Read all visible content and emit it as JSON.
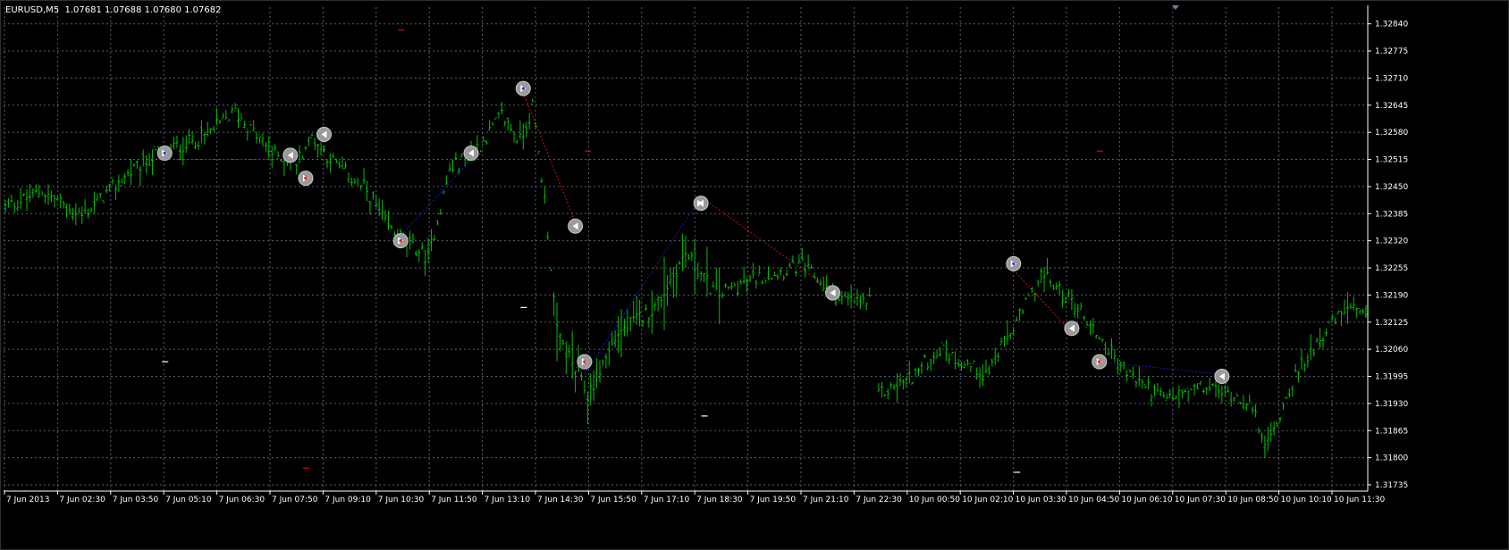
{
  "chart_data": {
    "type": "bar",
    "symbol": "EURUSD,M5",
    "ohlc": [
      "1.07681",
      "1.07688",
      "1.07680",
      "1.07682"
    ],
    "y_ticks": [
      "1.32840",
      "1.32775",
      "1.32710",
      "1.32645",
      "1.32580",
      "1.32515",
      "1.32450",
      "1.32385",
      "1.32320",
      "1.32255",
      "1.32190",
      "1.32125",
      "1.32060",
      "1.31995",
      "1.31930",
      "1.31865",
      "1.31800",
      "1.31735"
    ],
    "y_tick_values": [
      1.3284,
      1.32775,
      1.3271,
      1.32645,
      1.3258,
      1.32515,
      1.3245,
      1.32385,
      1.3232,
      1.32255,
      1.3219,
      1.32125,
      1.3206,
      1.31995,
      1.3193,
      1.31865,
      1.318,
      1.31735
    ],
    "ylim": [
      1.3172,
      1.3288
    ],
    "x_ticks": [
      "7 Jun 2013",
      "7 Jun 02:30",
      "7 Jun 03:50",
      "7 Jun 05:10",
      "7 Jun 06:30",
      "7 Jun 07:50",
      "7 Jun 09:10",
      "7 Jun 10:30",
      "7 Jun 11:50",
      "7 Jun 13:10",
      "7 Jun 14:30",
      "7 Jun 15:50",
      "7 Jun 17:10",
      "7 Jun 18:30",
      "7 Jun 19:50",
      "7 Jun 21:10",
      "7 Jun 22:30",
      "10 Jun 00:50",
      "10 Jun 02:10",
      "10 Jun 03:30",
      "10 Jun 04:50",
      "10 Jun 06:10",
      "10 Jun 07:30",
      "10 Jun 08:50",
      "10 Jun 10:10",
      "10 Jun 11:30"
    ],
    "bar_count": 420,
    "grid": true,
    "colors": {
      "background": "#000000",
      "bars": "#00c000",
      "grid": "#5a6070",
      "text": "#ffffff",
      "buy_line": "#1020c0",
      "sell_line": "#d01010",
      "marker": "#a0a0a0"
    },
    "path_anchors": [
      {
        "bar": 0,
        "price": 1.324
      },
      {
        "bar": 12,
        "price": 1.3244
      },
      {
        "bar": 25,
        "price": 1.3238
      },
      {
        "bar": 40,
        "price": 1.3248
      },
      {
        "bar": 50,
        "price": 1.3253
      },
      {
        "bar": 65,
        "price": 1.3257
      },
      {
        "bar": 75,
        "price": 1.3263
      },
      {
        "bar": 87,
        "price": 1.3253
      },
      {
        "bar": 95,
        "price": 1.3251
      },
      {
        "bar": 100,
        "price": 1.3257
      },
      {
        "bar": 108,
        "price": 1.325
      },
      {
        "bar": 118,
        "price": 1.3244
      },
      {
        "bar": 125,
        "price": 1.3235
      },
      {
        "bar": 138,
        "price": 1.3228
      },
      {
        "bar": 145,
        "price": 1.3249
      },
      {
        "bar": 155,
        "price": 1.3255
      },
      {
        "bar": 162,
        "price": 1.3262
      },
      {
        "bar": 168,
        "price": 1.3256
      },
      {
        "bar": 172,
        "price": 1.3264
      },
      {
        "bar": 176,
        "price": 1.3242
      },
      {
        "bar": 180,
        "price": 1.321
      },
      {
        "bar": 190,
        "price": 1.3195
      },
      {
        "bar": 200,
        "price": 1.321
      },
      {
        "bar": 212,
        "price": 1.3216
      },
      {
        "bar": 222,
        "price": 1.3229
      },
      {
        "bar": 232,
        "price": 1.3219
      },
      {
        "bar": 245,
        "price": 1.3223
      },
      {
        "bar": 260,
        "price": 1.3226
      },
      {
        "bar": 272,
        "price": 1.3218
      },
      {
        "bar": 282,
        "price": 1.3217
      },
      {
        "bar": 285,
        "price": 1.3195
      },
      {
        "bar": 295,
        "price": 1.3199
      },
      {
        "bar": 305,
        "price": 1.3206
      },
      {
        "bar": 320,
        "price": 1.32
      },
      {
        "bar": 332,
        "price": 1.3215
      },
      {
        "bar": 338,
        "price": 1.3224
      },
      {
        "bar": 350,
        "price": 1.3216
      },
      {
        "bar": 365,
        "price": 1.3201
      },
      {
        "bar": 378,
        "price": 1.3194
      },
      {
        "bar": 392,
        "price": 1.3197
      },
      {
        "bar": 405,
        "price": 1.3194
      },
      {
        "bar": 412,
        "price": 1.3183
      },
      {
        "bar": 420,
        "price": 1.3198
      },
      {
        "bar": 428,
        "price": 1.3208
      },
      {
        "bar": 438,
        "price": 1.3216
      },
      {
        "bar": 444,
        "price": 1.3213
      }
    ],
    "gap_after_bar": 282,
    "trade_lines": [
      {
        "type": "sell",
        "from": {
          "bar": 50,
          "price": 1.32515
        },
        "to": {
          "bar": 91,
          "price": 1.32515
        }
      },
      {
        "type": "buy",
        "from": {
          "bar": 130,
          "price": 1.3234
        },
        "to": {
          "bar": 152,
          "price": 1.32515
        }
      },
      {
        "type": "sell",
        "from": {
          "bar": 169,
          "price": 1.32675
        },
        "to": {
          "bar": 186,
          "price": 1.32365
        }
      },
      {
        "type": "buy",
        "from": {
          "bar": 189,
          "price": 1.32
        },
        "to": {
          "bar": 227,
          "price": 1.32425
        }
      },
      {
        "type": "sell",
        "from": {
          "bar": 227,
          "price": 1.32425
        },
        "to": {
          "bar": 270,
          "price": 1.322
        }
      },
      {
        "type": "sell",
        "from": {
          "bar": 329,
          "price": 1.3225
        },
        "to": {
          "bar": 348,
          "price": 1.321
        }
      },
      {
        "type": "buy",
        "from": {
          "bar": 357,
          "price": 1.3203
        },
        "to": {
          "bar": 397,
          "price": 1.32
        }
      }
    ],
    "trade_markers": [
      {
        "bar": 52,
        "price": 1.3253,
        "kind": "buy"
      },
      {
        "bar": 93,
        "price": 1.32525,
        "kind": "close"
      },
      {
        "bar": 98,
        "price": 1.3247,
        "kind": "sell"
      },
      {
        "bar": 104,
        "price": 1.32575,
        "kind": "close"
      },
      {
        "bar": 129,
        "price": 1.3232,
        "kind": "sell"
      },
      {
        "bar": 152,
        "price": 1.3253,
        "kind": "close"
      },
      {
        "bar": 169,
        "price": 1.32685,
        "kind": "buy"
      },
      {
        "bar": 186,
        "price": 1.32355,
        "kind": "close"
      },
      {
        "bar": 189,
        "price": 1.3203,
        "kind": "sell"
      },
      {
        "bar": 227,
        "price": 1.3241,
        "kind": "closebuy"
      },
      {
        "bar": 270,
        "price": 1.32195,
        "kind": "close"
      },
      {
        "bar": 329,
        "price": 1.32265,
        "kind": "buy"
      },
      {
        "bar": 348,
        "price": 1.3211,
        "kind": "close"
      },
      {
        "bar": 357,
        "price": 1.3203,
        "kind": "sell"
      },
      {
        "bar": 397,
        "price": 1.31995,
        "kind": "close"
      }
    ],
    "dashes": [
      {
        "bar": 129,
        "price": 1.32825,
        "color": "#d01010"
      },
      {
        "bar": 190,
        "price": 1.32535,
        "color": "#d01010"
      },
      {
        "bar": 357,
        "price": 1.32535,
        "color": "#d01010"
      },
      {
        "bar": 52,
        "price": 1.3203,
        "color": "#ffffff"
      },
      {
        "bar": 169,
        "price": 1.3216,
        "color": "#ffffff"
      },
      {
        "bar": 228,
        "price": 1.319,
        "color": "#ffffff"
      },
      {
        "bar": 98,
        "price": 1.31775,
        "color": "#d01010"
      },
      {
        "bar": 330,
        "price": 1.31765,
        "color": "#ffffff"
      }
    ]
  }
}
